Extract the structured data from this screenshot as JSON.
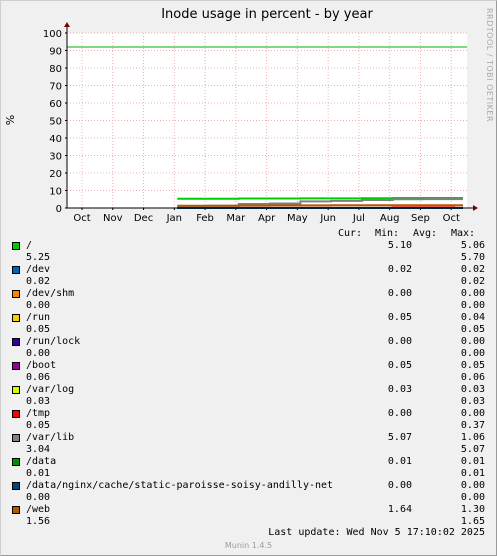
{
  "chart_data": {
    "type": "line",
    "title": "Inode usage in percent - by year",
    "ylabel": "%",
    "ylim": [
      0,
      100
    ],
    "yticks": [
      0,
      10,
      20,
      30,
      40,
      50,
      60,
      70,
      80,
      90,
      100
    ],
    "x_ticks": [
      "Oct",
      "Nov",
      "Dec",
      "Jan",
      "Feb",
      "Mar",
      "Apr",
      "May",
      "Jun",
      "Jul",
      "Aug",
      "Sep",
      "Oct"
    ],
    "grid": true,
    "warning_line": {
      "value": 92,
      "color": "#00b000"
    },
    "side_text": "RRDTOOL / TOBI OETIKER",
    "series": [
      {
        "name": "/",
        "color": "#00cc00",
        "start": "Jan",
        "values": [
          5.3,
          5.3,
          5.4,
          5.4,
          5.5,
          5.5,
          5.6,
          5.7,
          5.7,
          5.7
        ]
      },
      {
        "name": "/dev",
        "color": "#0066b3",
        "start": "Jan",
        "values": [
          0.02,
          0.02,
          0.02,
          0.02,
          0.02,
          0.02,
          0.02,
          0.02,
          0.02,
          0.02
        ]
      },
      {
        "name": "/dev/shm",
        "color": "#ff8000",
        "start": "Jan",
        "values": [
          0,
          0,
          0,
          0,
          0,
          0,
          0,
          0,
          0,
          0
        ]
      },
      {
        "name": "/run",
        "color": "#ffcc00",
        "start": "Jan",
        "values": [
          0.05,
          0.05,
          0.05,
          0.05,
          0.05,
          0.05,
          0.05,
          0.05,
          0.05,
          0.05
        ]
      },
      {
        "name": "/run/lock",
        "color": "#330099",
        "start": "Jan",
        "values": [
          0,
          0,
          0,
          0,
          0,
          0,
          0,
          0,
          0,
          0
        ]
      },
      {
        "name": "/boot",
        "color": "#990099",
        "start": "Jan",
        "values": [
          0.05,
          0.05,
          0.05,
          0.05,
          0.05,
          0.05,
          0.05,
          0.05,
          0.05,
          0.05
        ]
      },
      {
        "name": "/var/log",
        "color": "#ccff00",
        "start": "Jan",
        "values": [
          0.03,
          0.03,
          0.03,
          0.03,
          0.03,
          0.03,
          0.03,
          0.03,
          0.03,
          0.03
        ]
      },
      {
        "name": "/tmp",
        "color": "#ff0000",
        "start": "Jan",
        "values": [
          0,
          0,
          0,
          0,
          0,
          0,
          0,
          0.3,
          0.3,
          0
        ]
      },
      {
        "name": "/var/lib",
        "color": "#808080",
        "start": "Jan",
        "values": [
          1.1,
          1.3,
          2.3,
          2.6,
          3.8,
          4.1,
          4.6,
          5.0,
          5.1,
          5.1
        ]
      },
      {
        "name": "/data",
        "color": "#008f00",
        "start": "Jan",
        "values": [
          0.01,
          0.01,
          0.01,
          0.01,
          0.01,
          0.01,
          0.01,
          0.01,
          0.01,
          0.01
        ]
      },
      {
        "name": "/data/nginx/cache/static-paroisse-soisy-andilly-net",
        "color": "#00487d",
        "start": "Jan",
        "values": [
          0,
          0,
          0,
          0,
          0,
          0,
          0,
          0,
          0,
          0
        ]
      },
      {
        "name": "/web",
        "color": "#b35a00",
        "start": "Jan",
        "values": [
          1.3,
          1.3,
          1.4,
          1.5,
          1.5,
          1.6,
          1.6,
          1.6,
          1.6,
          1.6
        ]
      }
    ]
  },
  "legend": {
    "headers": {
      "cur": "Cur:",
      "min": "Min:",
      "avg": "Avg:",
      "max": "Max:"
    },
    "rows": [
      {
        "name": "/",
        "color": "#00cc00",
        "cur": "5.10",
        "v1": "5.06",
        "v2": "5.25",
        "v3": "5.70"
      },
      {
        "name": "/dev",
        "color": "#0066b3",
        "cur": "0.02",
        "v1": "0.02",
        "v2": "0.02",
        "v3": "0.02"
      },
      {
        "name": "/dev/shm",
        "color": "#ff8000",
        "cur": "0.00",
        "v1": "0.00",
        "v2": "0.00",
        "v3": "0.00"
      },
      {
        "name": "/run",
        "color": "#ffcc00",
        "cur": "0.05",
        "v1": "0.04",
        "v2": "0.05",
        "v3": "0.05"
      },
      {
        "name": "/run/lock",
        "color": "#330099",
        "cur": "0.00",
        "v1": "0.00",
        "v2": "0.00",
        "v3": "0.00"
      },
      {
        "name": "/boot",
        "color": "#990099",
        "cur": "0.05",
        "v1": "0.05",
        "v2": "0.06",
        "v3": "0.06"
      },
      {
        "name": "/var/log",
        "color": "#ccff00",
        "cur": "0.03",
        "v1": "0.03",
        "v2": "0.03",
        "v3": "0.03"
      },
      {
        "name": "/tmp",
        "color": "#ff0000",
        "cur": "0.00",
        "v1": "0.00",
        "v2": "0.05",
        "v3": "0.37"
      },
      {
        "name": "/var/lib",
        "color": "#808080",
        "cur": "5.07",
        "v1": "1.06",
        "v2": "3.04",
        "v3": "5.07"
      },
      {
        "name": "/data",
        "color": "#008f00",
        "cur": "0.01",
        "v1": "0.01",
        "v2": "0.01",
        "v3": "0.01"
      },
      {
        "name": "/data/nginx/cache/static-paroisse-soisy-andilly-net",
        "color": "#00487d",
        "cur": "0.00",
        "v1": "0.00",
        "v2": "0.00",
        "v3": "0.00"
      },
      {
        "name": "/web",
        "color": "#b35a00",
        "cur": "1.64",
        "v1": "1.30",
        "v2": "1.56",
        "v3": "1.65"
      }
    ]
  },
  "footer": {
    "last_update": "Last update: Wed Nov  5 17:10:02 2025",
    "munin": "Munin 1.4.5"
  }
}
